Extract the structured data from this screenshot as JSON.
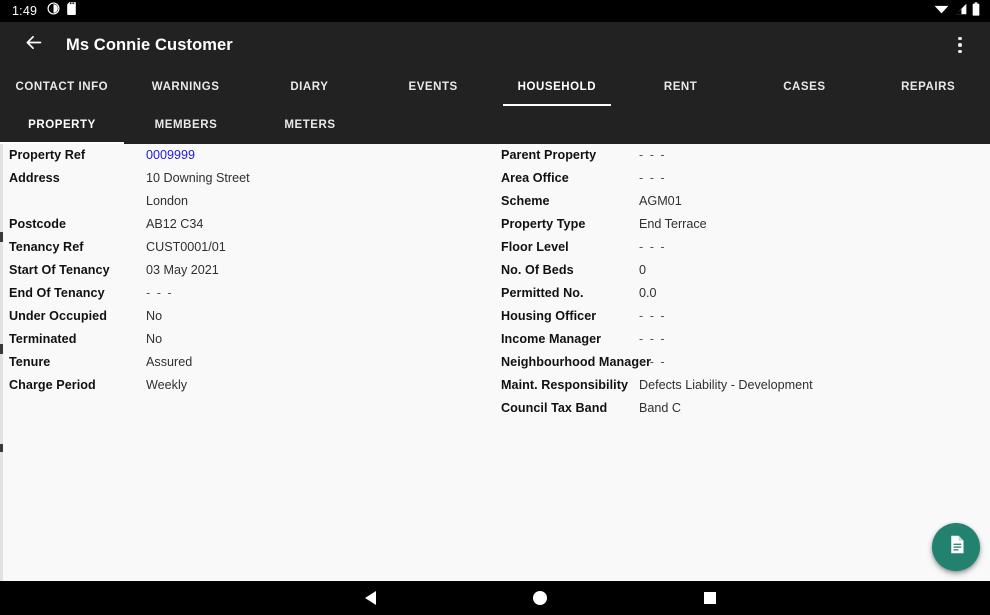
{
  "status_bar": {
    "clock": "1:49",
    "left_icons": [
      "brightness-icon",
      "sd-card-icon"
    ],
    "right_icons": [
      "wifi-icon",
      "cellular-signal-icon",
      "battery-icon"
    ]
  },
  "app_bar": {
    "back_icon": "arrow-left-icon",
    "title": "Ms Connie Customer",
    "overflow_icon": "more-vertical-icon"
  },
  "primary_tabs": {
    "active_index": 4,
    "items": [
      {
        "label": "CONTACT INFO"
      },
      {
        "label": "WARNINGS"
      },
      {
        "label": "DIARY"
      },
      {
        "label": "EVENTS"
      },
      {
        "label": "HOUSEHOLD"
      },
      {
        "label": "RENT"
      },
      {
        "label": "CASES"
      },
      {
        "label": "REPAIRS"
      }
    ]
  },
  "secondary_tabs": {
    "active_index": 0,
    "items": [
      {
        "label": "PROPERTY"
      },
      {
        "label": "MEMBERS"
      },
      {
        "label": "METERS"
      }
    ]
  },
  "property_details": {
    "left_column": [
      {
        "label": "Property Ref",
        "value": "0009999",
        "style": "link"
      },
      {
        "label": "Address",
        "value": "10 Downing Street",
        "value_line2": "London"
      },
      {
        "label": "Postcode",
        "value": "AB12 C34"
      },
      {
        "label": "Tenancy Ref",
        "value": "CUST0001/01"
      },
      {
        "label": "Start Of Tenancy",
        "value": "03 May 2021"
      },
      {
        "label": "End Of Tenancy",
        "value": "- - -",
        "style": "empty"
      },
      {
        "label": "Under Occupied",
        "value": "No"
      },
      {
        "label": "Terminated",
        "value": "No"
      },
      {
        "label": "Tenure",
        "value": "Assured"
      },
      {
        "label": "Charge Period",
        "value": "Weekly"
      }
    ],
    "right_column": [
      {
        "label": "Parent Property",
        "value": "- - -",
        "style": "empty"
      },
      {
        "label": "Area Office",
        "value": "- - -",
        "style": "empty"
      },
      {
        "label": "Scheme",
        "value": "AGM01"
      },
      {
        "label": "Property Type",
        "value": "End Terrace"
      },
      {
        "label": "Floor Level",
        "value": "- - -",
        "style": "empty"
      },
      {
        "label": "No. Of Beds",
        "value": "0"
      },
      {
        "label": "Permitted No.",
        "value": "0.0"
      },
      {
        "label": "Housing Officer",
        "value": "- - -",
        "style": "empty"
      },
      {
        "label": "Income Manager",
        "value": "- - -",
        "style": "empty"
      },
      {
        "label": "Neighbourhood Manager",
        "value": "- - -",
        "style": "empty"
      },
      {
        "label": "Maint. Responsibility",
        "value": "Defects Liability - Development"
      },
      {
        "label": "Council Tax Band",
        "value": "Band C"
      }
    ]
  },
  "fab": {
    "icon": "document-icon",
    "color": "#22826f"
  },
  "nav_bar": {
    "back_icon": "nav-back-triangle-icon",
    "home_icon": "nav-home-circle-icon",
    "recents_icon": "nav-recents-square-icon"
  },
  "colors": {
    "app_bar": "#222222",
    "content_bg": "#f9f9f9",
    "link": "#1a1ae6",
    "accent": "#22826f"
  }
}
